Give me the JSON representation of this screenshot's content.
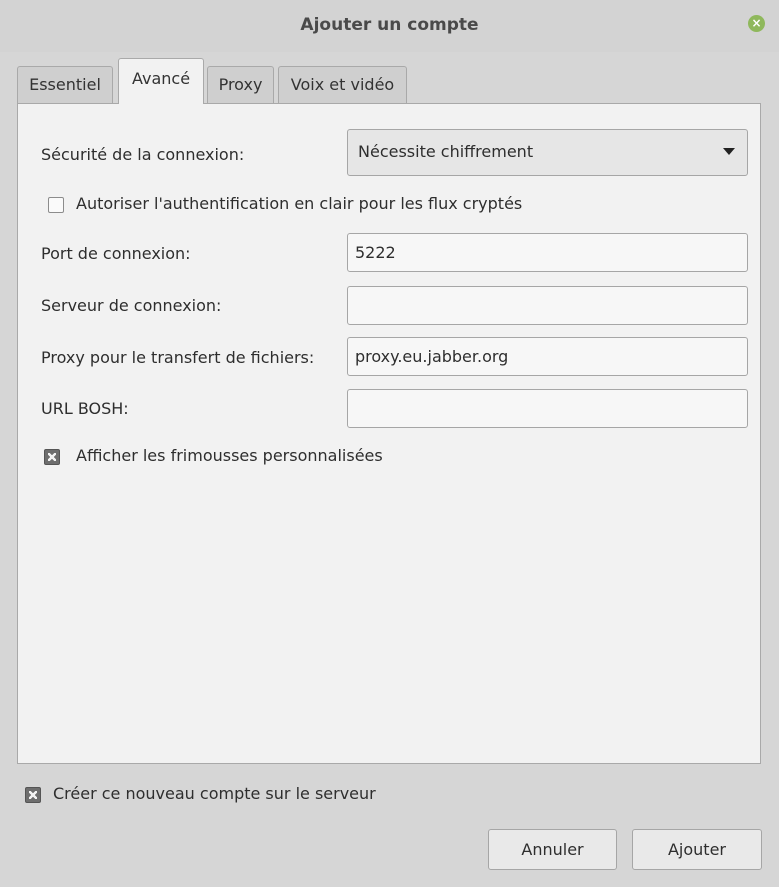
{
  "window": {
    "title": "Ajouter un compte",
    "close_icon": "close-icon",
    "close_color": "#8fb85c"
  },
  "tabs": [
    {
      "label": "Essentiel",
      "active": false
    },
    {
      "label": "Avancé",
      "active": true
    },
    {
      "label": "Proxy",
      "active": false
    },
    {
      "label": "Voix et vidéo",
      "active": false
    }
  ],
  "advanced": {
    "security": {
      "label": "Sécurité de la connexion:",
      "value": "Nécessite chiffrement",
      "arrow_icon": "chevron-down-icon"
    },
    "plaintext_auth": {
      "label": "Autoriser l'authentification en clair pour les flux cryptés",
      "checked": false
    },
    "port": {
      "label": "Port de connexion:",
      "value": "5222"
    },
    "server": {
      "label": "Serveur de connexion:",
      "value": ""
    },
    "file_proxy": {
      "label": "Proxy pour le transfert de fichiers:",
      "value": "proxy.eu.jabber.org"
    },
    "bosh": {
      "label": "URL BOSH:",
      "value": ""
    },
    "custom_smileys": {
      "label": "Afficher les frimousses personnalisées",
      "checked": true
    }
  },
  "create_account": {
    "label": "Créer ce nouveau compte sur le serveur",
    "checked": true
  },
  "buttons": {
    "cancel": "Annuler",
    "add": "Ajouter"
  }
}
